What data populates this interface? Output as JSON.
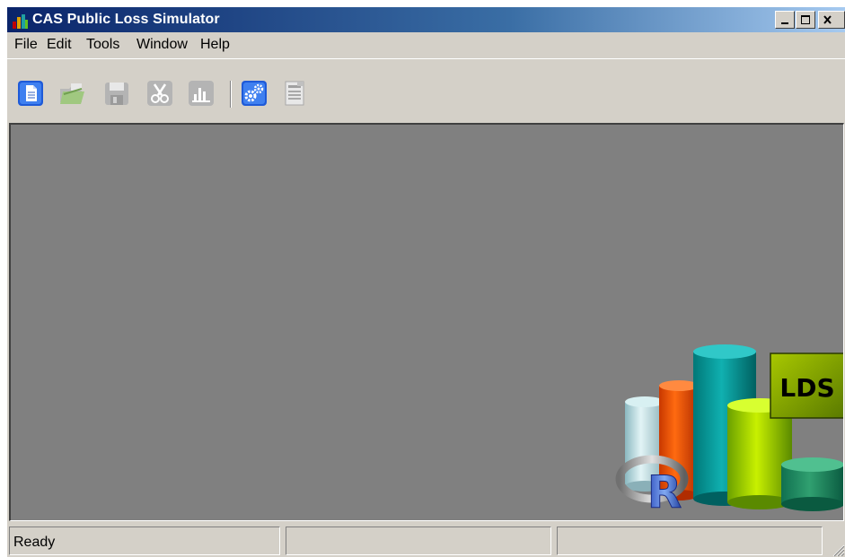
{
  "window": {
    "title": "CAS Public Loss Simulator",
    "controls": [
      "minimize",
      "maximize",
      "close"
    ]
  },
  "menu": {
    "items": [
      {
        "label": "File"
      },
      {
        "label": "Edit"
      },
      {
        "label": "Tools"
      },
      {
        "label": "Window"
      },
      {
        "label": "Help"
      }
    ]
  },
  "toolbar": {
    "buttons": [
      {
        "icon": "new-document-icon",
        "enabled": true
      },
      {
        "icon": "open-folder-icon",
        "enabled": false
      },
      {
        "icon": "save-icon",
        "enabled": false
      },
      {
        "icon": "cut-icon",
        "enabled": false
      },
      {
        "icon": "bar-chart-icon",
        "enabled": false
      },
      {
        "icon": "gears-icon",
        "enabled": true
      },
      {
        "icon": "report-icon",
        "enabled": false
      }
    ]
  },
  "logo": {
    "badge_text": "LDS",
    "r_letter": "R"
  },
  "statusbar": {
    "status_text": "Ready",
    "pane2_text": "",
    "pane3_text": ""
  },
  "colors": {
    "title_start": "#0a246a",
    "title_end": "#a6caf0",
    "face": "#d4d0c8",
    "client_bg": "#808080",
    "badge_bg": "#7a9a00"
  }
}
